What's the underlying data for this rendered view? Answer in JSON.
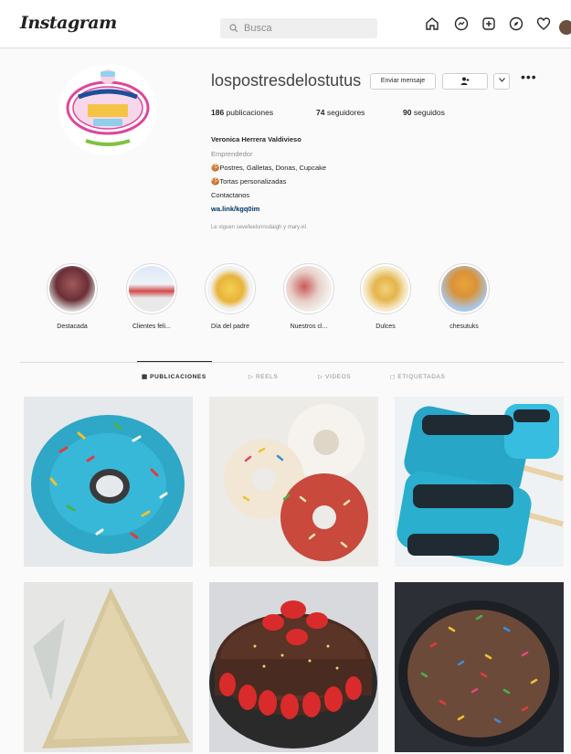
{
  "header": {
    "logo": "Instagram",
    "search_placeholder": "Busca",
    "nav_icons": [
      "home-icon",
      "messenger-icon",
      "new-post-icon",
      "explore-icon",
      "heart-icon",
      "avatar"
    ]
  },
  "profile": {
    "username": "lospostresdelostutus",
    "message_button": "Enviar mensaje",
    "stats": {
      "posts_count": "186",
      "posts_label": "publicaciones",
      "followers_count": "74",
      "followers_label": "seguidores",
      "following_count": "90",
      "following_label": "seguidos"
    },
    "bio": {
      "name": "Veronica Herrera Valdivieso",
      "category": "Emprendedor",
      "line1": "🍪Postres, Galletas, Donas, Cupcake",
      "line2": "🍪Tortas personalizadas",
      "line3": "Contactanos",
      "link": "wa.link/kgq0im",
      "followed_by": "Le siguen sevefeelsnnsdaigh y mary.vii"
    }
  },
  "highlights": [
    {
      "label": "Destacada"
    },
    {
      "label": "Clientes feli..."
    },
    {
      "label": "Día del padre"
    },
    {
      "label": "Nuestros cl..."
    },
    {
      "label": "Dulces"
    },
    {
      "label": "chesutuks"
    }
  ],
  "tabs": [
    {
      "label": "PUBLICACIONES",
      "icon": "grid-icon",
      "active": true
    },
    {
      "label": "REELS",
      "icon": "reels-icon",
      "active": false
    },
    {
      "label": "VIDEOS",
      "icon": "video-icon",
      "active": false
    },
    {
      "label": "ETIQUETADAS",
      "icon": "tagged-icon",
      "active": false
    }
  ],
  "colors": {
    "link": "#00376b",
    "border": "#dbdbdb",
    "secondary_text": "#8e8e8e"
  }
}
